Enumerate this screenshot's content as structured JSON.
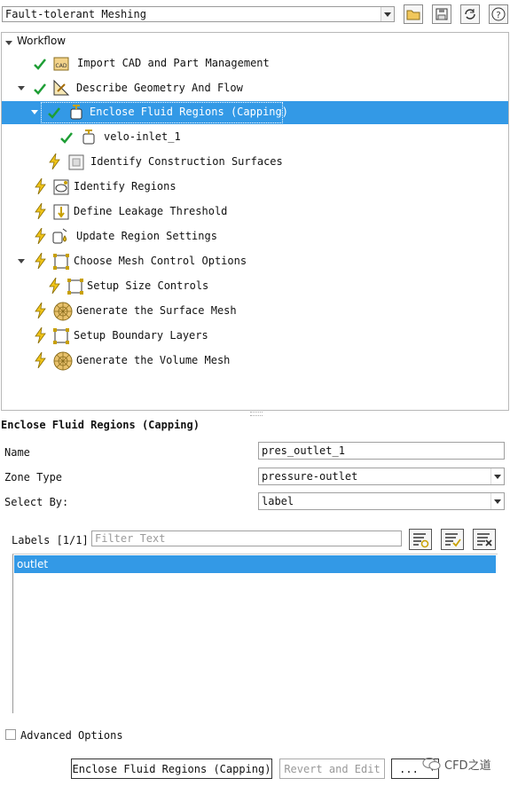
{
  "toolbar": {
    "workflow_select": "Fault-tolerant Meshing"
  },
  "tree": {
    "root_label": "Workflow",
    "items": [
      {
        "label": "Import CAD and Part Management",
        "status": "done"
      },
      {
        "label": "Describe Geometry And Flow",
        "status": "done"
      },
      {
        "label": "Enclose Fluid Regions (Capping)",
        "status": "done",
        "selected": true
      },
      {
        "label": "velo-inlet_1",
        "status": "done"
      },
      {
        "label": "Identify Construction Surfaces",
        "status": "pending"
      },
      {
        "label": "Identify Regions",
        "status": "pending"
      },
      {
        "label": "Define Leakage Threshold",
        "status": "pending"
      },
      {
        "label": "Update Region Settings",
        "status": "pending"
      },
      {
        "label": "Choose Mesh Control Options",
        "status": "pending"
      },
      {
        "label": "Setup Size Controls",
        "status": "pending"
      },
      {
        "label": "Generate the Surface Mesh",
        "status": "pending"
      },
      {
        "label": "Setup Boundary Layers",
        "status": "pending"
      },
      {
        "label": "Generate the Volume Mesh",
        "status": "pending"
      }
    ]
  },
  "task_panel": {
    "title": "Enclose Fluid Regions (Capping)",
    "name_label": "Name",
    "name_value": "pres_outlet_1",
    "zone_type_label": "Zone Type",
    "zone_type_value": "pressure-outlet",
    "select_by_label": "Select By:",
    "select_by_value": "label",
    "labels_heading": "Labels [1/1]",
    "filter_placeholder": "Filter Text",
    "labels": [
      "outlet"
    ],
    "advanced_options_label": "Advanced Options",
    "advanced_options_checked": false
  },
  "buttons": {
    "primary": "Enclose Fluid Regions (Capping)",
    "revert": "Revert and Edit",
    "more": "...",
    "more_arrow": "▾"
  },
  "watermark": "CFD之道",
  "colors": {
    "selection": "#3399e6",
    "check": "#1e9e35",
    "bolt": "#f0c419"
  }
}
